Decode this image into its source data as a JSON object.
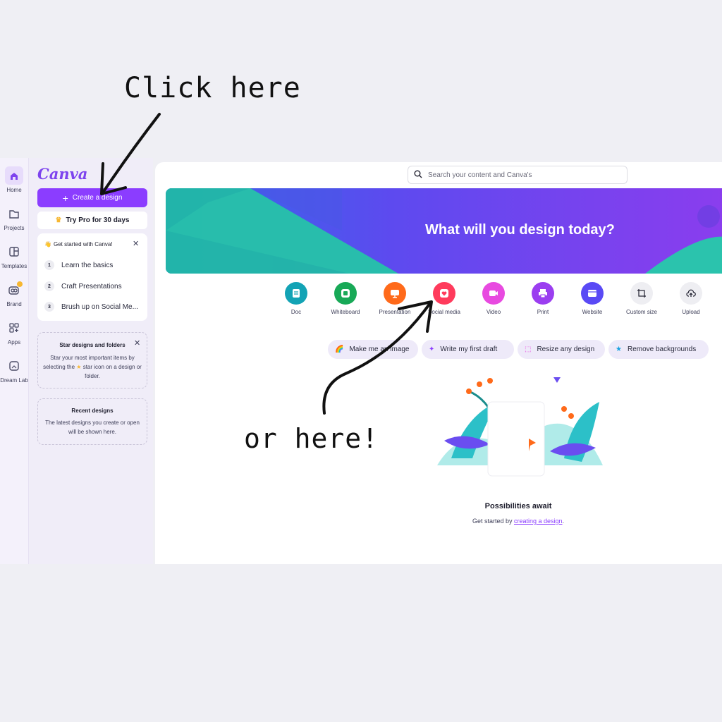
{
  "annotations": {
    "click_here": "Click here",
    "or_here": "or here!"
  },
  "rail": {
    "items": [
      {
        "label": "Home",
        "icon": "home-icon"
      },
      {
        "label": "Projects",
        "icon": "folder-icon"
      },
      {
        "label": "Templates",
        "icon": "templates-icon"
      },
      {
        "label": "Brand",
        "icon": "brand-icon"
      },
      {
        "label": "Apps",
        "icon": "apps-icon"
      },
      {
        "label": "Dream Lab",
        "icon": "dream-lab-icon"
      }
    ]
  },
  "sidebar": {
    "logo": "Canva",
    "create_label": "Create a design",
    "pro_label": "Try Pro for 30 days",
    "get_started": {
      "title": "Get started with Canva!",
      "steps": [
        {
          "n": "1",
          "label": "Learn the basics"
        },
        {
          "n": "2",
          "label": "Craft Presentations"
        },
        {
          "n": "3",
          "label": "Brush up on Social Me..."
        }
      ]
    },
    "star": {
      "title": "Star designs and folders",
      "body_pre": "Star your most important items by selecting the",
      "body_post": "star icon on a design or folder."
    },
    "recent": {
      "title": "Recent designs",
      "body": "The latest designs you create or open will be shown here."
    }
  },
  "search": {
    "placeholder": "Search your content and Canva's"
  },
  "banner": {
    "title": "What will you design today?"
  },
  "design_types": [
    {
      "label": "Doc",
      "color": "#13a3b5",
      "icon": "doc-icon"
    },
    {
      "label": "Whiteboard",
      "color": "#18a957",
      "icon": "whiteboard-icon"
    },
    {
      "label": "Presentation",
      "color": "#ff6a1a",
      "icon": "presentation-icon"
    },
    {
      "label": "Social media",
      "color": "#ff3b5c",
      "icon": "social-media-icon"
    },
    {
      "label": "Video",
      "color": "#e84ae0",
      "icon": "video-icon"
    },
    {
      "label": "Print",
      "color": "#9b3ef0",
      "icon": "print-icon"
    },
    {
      "label": "Website",
      "color": "#5a4af5",
      "icon": "website-icon"
    },
    {
      "label": "Custom size",
      "color": "#eeeef2",
      "icon": "custom-size-icon"
    },
    {
      "label": "Upload",
      "color": "#eeeef2",
      "icon": "upload-icon"
    }
  ],
  "quick_actions": [
    {
      "label": "Make me an image",
      "icon": "rainbow-icon"
    },
    {
      "label": "Write my first draft",
      "icon": "magic-wand-icon"
    },
    {
      "label": "Resize any design",
      "icon": "resize-icon"
    },
    {
      "label": "Remove backgrounds",
      "icon": "star-icon"
    }
  ],
  "empty_state": {
    "title": "Possibilities await",
    "sub_pre": "Get started by",
    "sub_link": "creating a design",
    "sub_post": "."
  },
  "colors": {
    "accent": "#8b3dff",
    "page_bg": "#efeff4"
  }
}
